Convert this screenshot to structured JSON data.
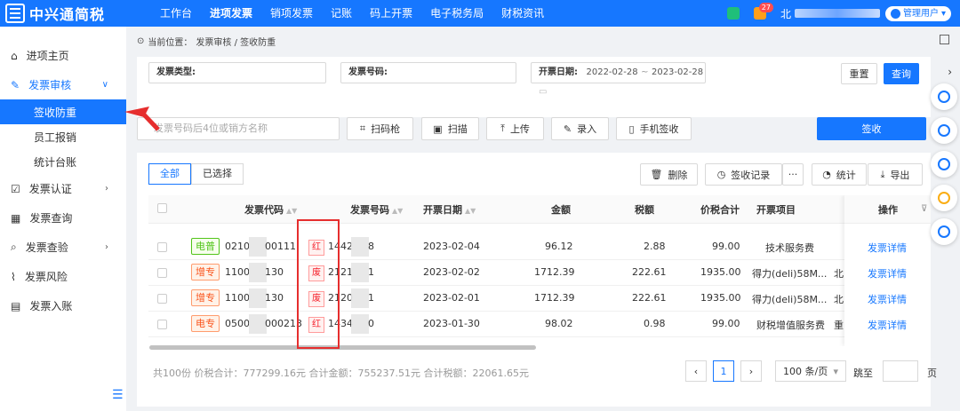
{
  "app": {
    "title": "中兴通简税"
  },
  "nav": [
    "工作台",
    "进项发票",
    "销项发票",
    "记账",
    "码上开票",
    "电子税务局",
    "财税资讯"
  ],
  "top_right": {
    "notif_count": "27",
    "user_prefix": "北",
    "user_role": "管理用户"
  },
  "sidebar": {
    "items": [
      {
        "label": "进项主页",
        "icon": "home-icon"
      },
      {
        "label": "发票审核",
        "icon": "edit-icon",
        "expanded": true,
        "children": [
          "签收防重",
          "员工报销",
          "统计台账"
        ]
      },
      {
        "label": "发票认证",
        "icon": "check-square-icon"
      },
      {
        "label": "发票查询",
        "icon": "grid-icon"
      },
      {
        "label": "发票查验",
        "icon": "doc-search-icon"
      },
      {
        "label": "发票风险",
        "icon": "pulse-icon"
      },
      {
        "label": "发票入账",
        "icon": "book-icon"
      }
    ]
  },
  "breadcrumb": {
    "prefix": "当前位置：",
    "path": "发票审核 / 签收防重"
  },
  "filter": {
    "type_label": "发票类型:",
    "number_label": "发票号码:",
    "date_label": "开票日期:",
    "date_from": "2022-02-28",
    "date_sep": "~",
    "date_to": "2023-02-28",
    "reset": "重置",
    "query": "查询"
  },
  "actions": {
    "search_placeholder": "发票号码后4位或销方名称",
    "scan_gun": "扫码枪",
    "scan": "扫描",
    "upload": "上传",
    "entry": "录入",
    "phone_sign": "手机签收",
    "sign": "签收"
  },
  "tabs": [
    "全部",
    "已选择"
  ],
  "list_actions": {
    "delete": "删除",
    "records": "签收记录",
    "more": "···",
    "stats": "统计",
    "export": "导出"
  },
  "columns": [
    "发票代码",
    "发票号码",
    "开票日期",
    "金额",
    "税额",
    "价税合计",
    "开票项目",
    "操作"
  ],
  "rows": [
    {
      "type": "电普",
      "type_color": "green",
      "code": "0210",
      "code_tail": "00111",
      "status": "红",
      "number": "1442",
      "number_tail": "8",
      "date": "2023-02-04",
      "amount": "96.12",
      "tax": "2.88",
      "total": "99.00",
      "item": "技术服务费",
      "action": "发票详情"
    },
    {
      "type": "增专",
      "type_color": "orange",
      "code": "1100",
      "code_tail": "130",
      "status": "废",
      "number": "2121",
      "number_tail": "1",
      "date": "2023-02-02",
      "amount": "1712.39",
      "tax": "222.61",
      "total": "1935.00",
      "item": "得力(deli)58M...",
      "item_extra": "北",
      "action": "发票详情"
    },
    {
      "type": "增专",
      "type_color": "orange",
      "code": "1100",
      "code_tail": "130",
      "status": "废",
      "number": "2120",
      "number_tail": "1",
      "date": "2023-02-01",
      "amount": "1712.39",
      "tax": "222.61",
      "total": "1935.00",
      "item": "得力(deli)58M...",
      "item_extra": "北",
      "action": "发票详情"
    },
    {
      "type": "电专",
      "type_color": "orange",
      "code": "0500",
      "code_tail": "000213",
      "status": "红",
      "number": "1434",
      "number_tail": "0",
      "date": "2023-01-30",
      "amount": "98.02",
      "tax": "0.98",
      "total": "99.00",
      "item": "财税增值服务费",
      "item_extra": "重",
      "action": "发票详情"
    }
  ],
  "summary": "共100份 价税合计：777299.16元 合计金额：755237.51元 合计税额：22061.65元",
  "pager": {
    "current": "1",
    "size": "100 条/页",
    "goto": "跳至",
    "page_unit": "页"
  }
}
